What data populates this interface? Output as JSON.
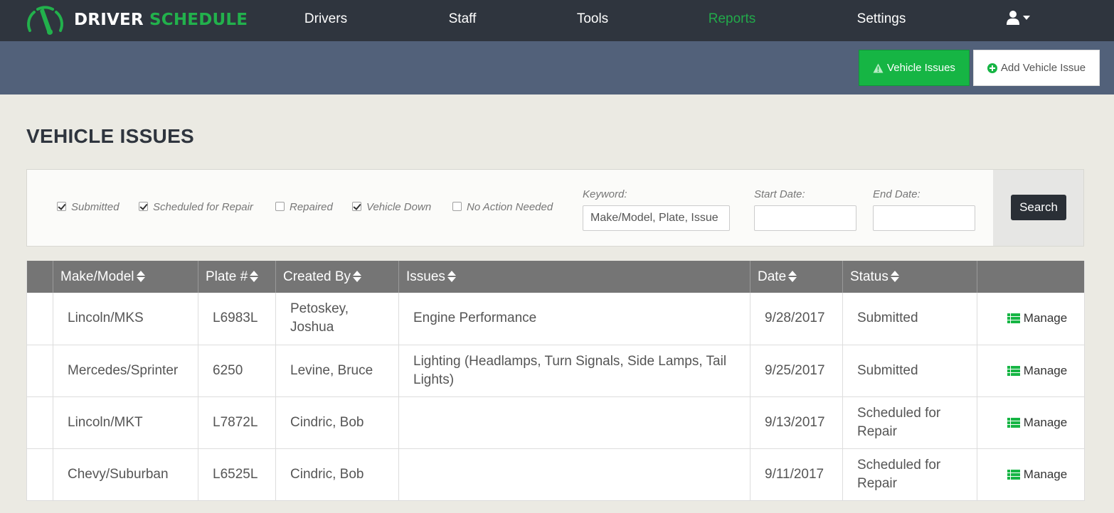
{
  "brand": {
    "name_white": "DRIVER",
    "name_green": "SCHEDULE"
  },
  "nav": {
    "items": [
      "Drivers",
      "Staff",
      "Tools",
      "Reports",
      "Settings"
    ],
    "active": "Reports"
  },
  "actions": {
    "vehicle_issues_label": "Vehicle Issues",
    "add_vehicle_issue_label": "Add Vehicle Issue"
  },
  "page": {
    "title": "VEHICLE ISSUES"
  },
  "filters": {
    "statuses": [
      {
        "label": "Submitted",
        "checked": true
      },
      {
        "label": "Scheduled for Repair",
        "checked": true
      },
      {
        "label": "Repaired",
        "checked": false
      },
      {
        "label": "Vehicle Down",
        "checked": true
      },
      {
        "label": "No Action Needed",
        "checked": false
      }
    ],
    "keyword_label": "Keyword:",
    "keyword_placeholder": "Make/Model, Plate, Issue",
    "start_date_label": "Start Date:",
    "end_date_label": "End Date:",
    "search_label": "Search"
  },
  "table": {
    "columns": [
      "Make/Model",
      "Plate #",
      "Created By",
      "Issues",
      "Date",
      "Status"
    ],
    "manage_label": "Manage",
    "rows": [
      {
        "make_model": "Lincoln/MKS",
        "plate": "L6983L",
        "created_by": "Petoskey, Joshua",
        "issues": "Engine Performance",
        "date": "9/28/2017",
        "status": "Submitted"
      },
      {
        "make_model": "Mercedes/Sprinter",
        "plate": "6250",
        "created_by": "Levine, Bruce",
        "issues": "Lighting (Headlamps, Turn Signals, Side Lamps, Tail Lights)",
        "date": "9/25/2017",
        "status": "Submitted"
      },
      {
        "make_model": "Lincoln/MKT",
        "plate": "L7872L",
        "created_by": "Cindric, Bob",
        "issues": "",
        "date": "9/13/2017",
        "status": "Scheduled for Repair"
      },
      {
        "make_model": "Chevy/Suburban",
        "plate": "L6525L",
        "created_by": "Cindric, Bob",
        "issues": "",
        "date": "9/11/2017",
        "status": "Scheduled for Repair"
      }
    ]
  },
  "colors": {
    "nav_bg": "#2f353e",
    "accent_green": "#22b14c",
    "subbar_bg": "#52617a",
    "page_bg": "#ebeae3",
    "table_header_bg": "#757575"
  }
}
